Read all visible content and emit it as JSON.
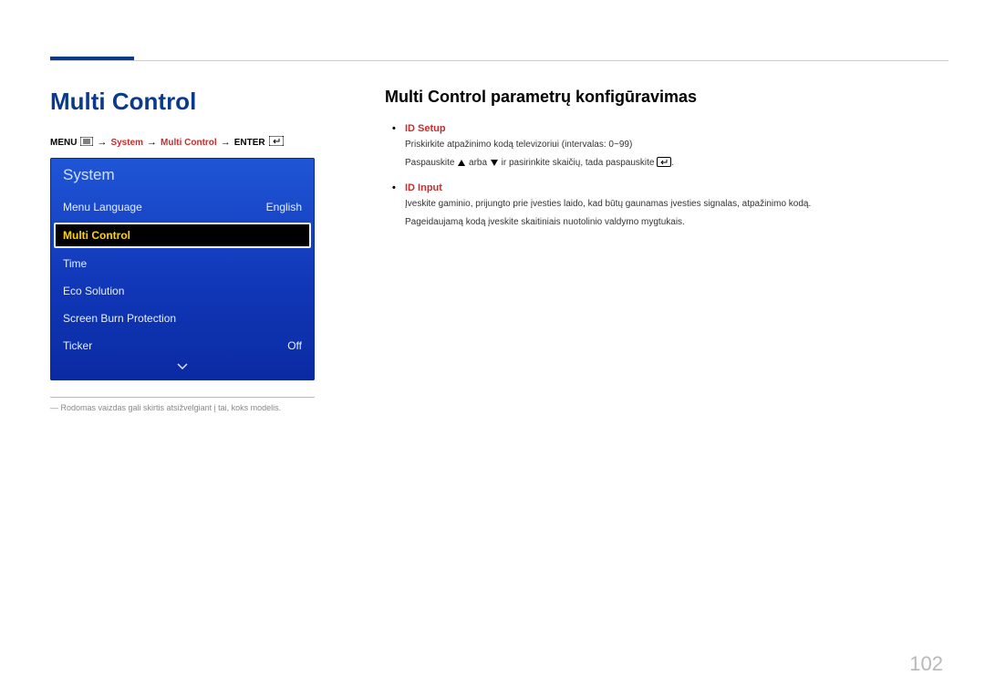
{
  "page_title": "Multi Control",
  "breadcrumb": {
    "menu": "MENU",
    "system": "System",
    "multi_control": "Multi Control",
    "enter": "ENTER"
  },
  "tv_panel": {
    "header": "System",
    "items": [
      {
        "label": "Menu Language",
        "value": "English",
        "selected": false
      },
      {
        "label": "Multi Control",
        "value": "",
        "selected": true
      },
      {
        "label": "Time",
        "value": "",
        "selected": false
      },
      {
        "label": "Eco Solution",
        "value": "",
        "selected": false
      },
      {
        "label": "Screen Burn Protection",
        "value": "",
        "selected": false
      },
      {
        "label": "Ticker",
        "value": "Off",
        "selected": false
      }
    ]
  },
  "footnote": "Rodomas vaizdas gali skirtis atsižvelgiant į tai, koks modelis.",
  "section_title": "Multi Control parametrų konfigūravimas",
  "id_setup": {
    "heading": "ID Setup",
    "line1": "Priskirkite atpažinimo kodą televizoriui (intervalas: 0~99)",
    "line2a": "Paspauskite ",
    "line2b": " arba ",
    "line2c": " ir pasirinkite skaičių, tada paspauskite ",
    "line2d": "."
  },
  "id_input": {
    "heading": "ID Input",
    "line1": "Įveskite gaminio, prijungto prie įvesties laido, kad būtų gaunamas įvesties signalas, atpažinimo kodą.",
    "line2": "Pageidaujamą kodą įveskite skaitiniais nuotolinio valdymo mygtukais."
  },
  "page_number": "102"
}
